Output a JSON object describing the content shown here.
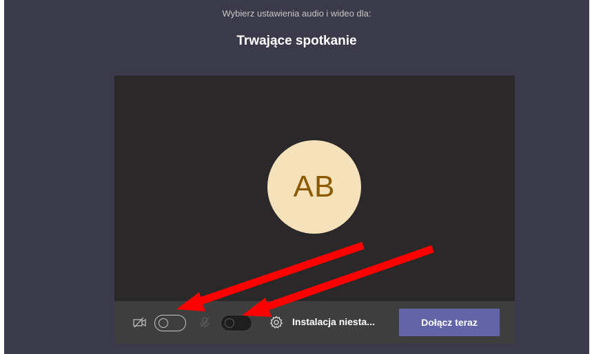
{
  "header": {
    "subtitle": "Wybierz ustawienia audio i wideo dla:",
    "title": "Trwające spotkanie"
  },
  "preview": {
    "avatar_initials": "AB"
  },
  "toolbar": {
    "camera_icon": "camera-off-icon",
    "camera_toggle": "off",
    "mic_icon": "microphone-off-icon",
    "mic_toggle": "off",
    "settings_icon": "gear-icon",
    "device_settings_label": "Instalacja niesta...",
    "join_label": "Dołącz teraz"
  },
  "colors": {
    "background": "#3b3a4a",
    "preview": "#2a2828",
    "avatar_bg": "#f5e2ba",
    "avatar_text": "#8b5a00",
    "join_button": "#6264a7",
    "annotation_arrows": "#ff0000"
  }
}
